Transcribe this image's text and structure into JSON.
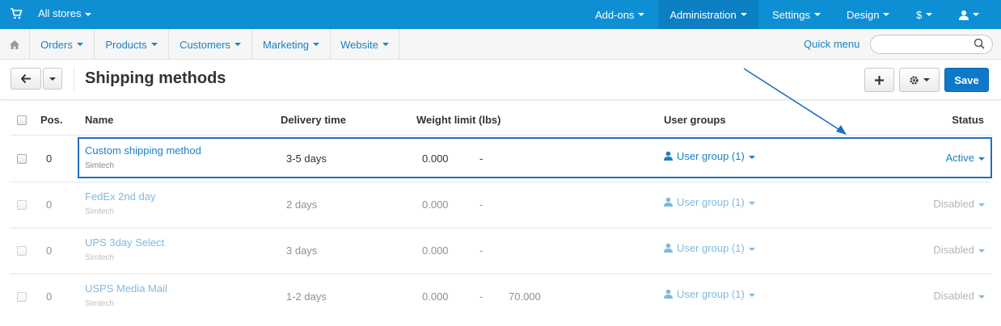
{
  "topbar": {
    "stores_label": "All stores",
    "nav": [
      {
        "label": "Add-ons"
      },
      {
        "label": "Administration"
      },
      {
        "label": "Settings"
      },
      {
        "label": "Design"
      },
      {
        "label": "$"
      }
    ]
  },
  "navbar": {
    "items": [
      {
        "label": "Orders"
      },
      {
        "label": "Products"
      },
      {
        "label": "Customers"
      },
      {
        "label": "Marketing"
      },
      {
        "label": "Website"
      }
    ],
    "quick_menu": "Quick menu",
    "search_placeholder": ""
  },
  "page": {
    "title": "Shipping methods",
    "save_label": "Save"
  },
  "table": {
    "headers": {
      "pos": "Pos.",
      "name": "Name",
      "delivery": "Delivery time",
      "weight": "Weight limit (lbs)",
      "groups": "User groups",
      "status": "Status"
    },
    "rows": [
      {
        "pos": "0",
        "name": "Custom shipping method",
        "vendor": "Simtech",
        "delivery": "3-5 days",
        "weight_min": "0.000",
        "dash": "-",
        "weight_max": "",
        "group": "User group (1)",
        "status": "Active"
      },
      {
        "pos": "0",
        "name": "FedEx 2nd day",
        "vendor": "Simtech",
        "delivery": "2 days",
        "weight_min": "0.000",
        "dash": "-",
        "weight_max": "",
        "group": "User group (1)",
        "status": "Disabled"
      },
      {
        "pos": "0",
        "name": "UPS 3day Select",
        "vendor": "Simtech",
        "delivery": "3 days",
        "weight_min": "0.000",
        "dash": "-",
        "weight_max": "",
        "group": "User group (1)",
        "status": "Disabled"
      },
      {
        "pos": "0",
        "name": "USPS Media Mail",
        "vendor": "Simtech",
        "delivery": "1-2 days",
        "weight_min": "0.000",
        "dash": "-",
        "weight_max": "70.000",
        "group": "User group (1)",
        "status": "Disabled"
      }
    ]
  },
  "colors": {
    "topbar": "#0f8fd3",
    "accent": "#1a7fc4",
    "save": "#0e79c8",
    "highlight": "#1f6fc0"
  }
}
